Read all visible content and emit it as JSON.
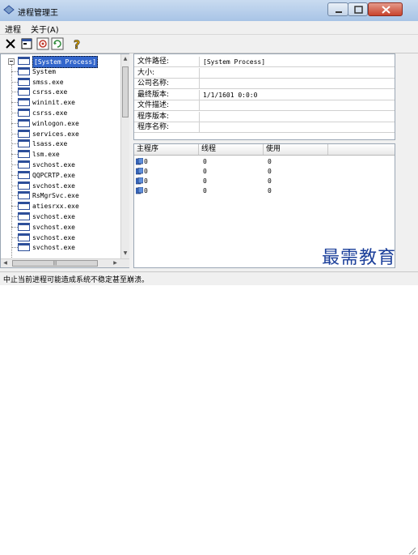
{
  "window": {
    "title": "进程管理王"
  },
  "menu": {
    "items": [
      "进程",
      "关于(A)"
    ]
  },
  "toolbar": {
    "icons": [
      "close-x-icon",
      "process-window-icon",
      "target-icon",
      "refresh-icon",
      "help-icon"
    ]
  },
  "tree": {
    "root": "[System Process]",
    "items": [
      "System",
      "smss.exe",
      "csrss.exe",
      "wininit.exe",
      "csrss.exe",
      "winlogon.exe",
      "services.exe",
      "lsass.exe",
      "lsm.exe",
      "svchost.exe",
      "QQPCRTP.exe",
      "svchost.exe",
      "RsMgrSvc.exe",
      "atiesrxx.exe",
      "svchost.exe",
      "svchost.exe",
      "svchost.exe",
      "svchost.exe"
    ]
  },
  "info": {
    "rows": [
      {
        "key": "文件路径:",
        "value": "[System Process]"
      },
      {
        "key": "大小:",
        "value": ""
      },
      {
        "key": "公司名称:",
        "value": ""
      },
      {
        "key": "最终版本:",
        "value": "1/1/1601 0:0:0"
      },
      {
        "key": "文件描述:",
        "value": ""
      },
      {
        "key": "程序版本:",
        "value": ""
      },
      {
        "key": "程序名称:",
        "value": ""
      }
    ]
  },
  "threads": {
    "columns": [
      "主程序",
      "线程",
      "使用"
    ],
    "rows": [
      [
        "0",
        "0",
        "0"
      ],
      [
        "0",
        "0",
        "0"
      ],
      [
        "0",
        "0",
        "0"
      ],
      [
        "0",
        "0",
        "0"
      ]
    ]
  },
  "status": {
    "text": "中止当前进程可能造成系统不稳定甚至崩溃。"
  },
  "watermark": {
    "text": "最需教育"
  },
  "colors": {
    "selection": "#3366cc",
    "watermark": "#1b3f9a",
    "titlebar": "#c9dbf0"
  }
}
